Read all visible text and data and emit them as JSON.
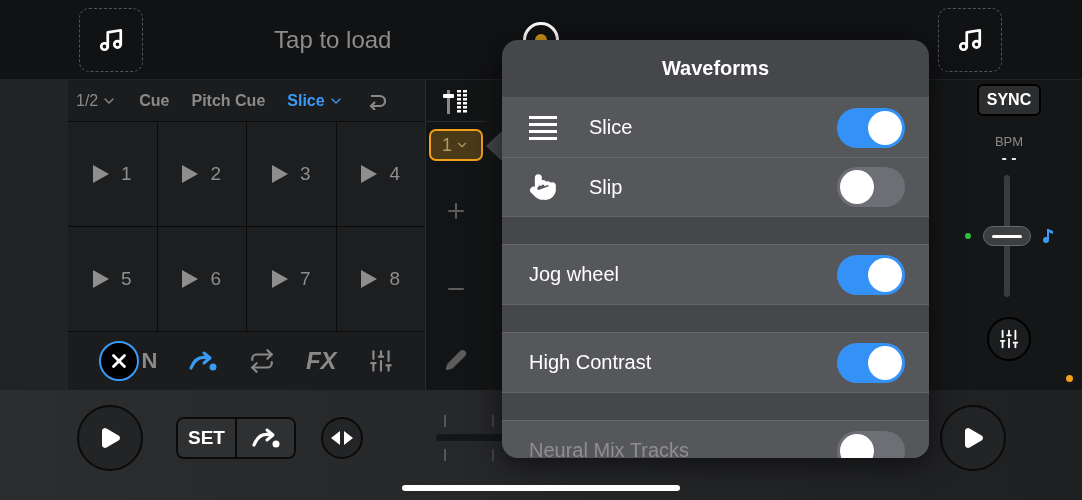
{
  "decks": [
    {
      "track": "Tap to load"
    }
  ],
  "pad_toolbar": {
    "page": "1/2",
    "modes": [
      {
        "label": "Cue",
        "selected": false
      },
      {
        "label": "Pitch Cue",
        "selected": false
      },
      {
        "label": "Slice",
        "selected": true
      }
    ]
  },
  "pads": [
    "1",
    "2",
    "3",
    "4",
    "5",
    "6",
    "7",
    "8"
  ],
  "tools": [
    {
      "kind": "stems",
      "label": "N",
      "on": true
    },
    {
      "kind": "cue",
      "on": true
    },
    {
      "kind": "loop",
      "on": false
    },
    {
      "kind": "fx",
      "label": "FX",
      "on": false
    },
    {
      "kind": "mixer",
      "on": false
    }
  ],
  "strip": {
    "zoom": "1"
  },
  "popup": {
    "title": "Waveforms",
    "sections": [
      {
        "rows": [
          {
            "kind": "slice",
            "label": "Slice",
            "on": true,
            "disabled": false
          },
          {
            "kind": "slip",
            "label": "Slip",
            "on": false,
            "disabled": false
          }
        ]
      },
      {
        "rows": [
          {
            "kind": "plain",
            "label": "Jog wheel",
            "on": true,
            "disabled": false
          }
        ]
      },
      {
        "rows": [
          {
            "kind": "plain",
            "label": "High Contrast",
            "on": true,
            "disabled": false
          }
        ]
      },
      {
        "rows": [
          {
            "kind": "plain",
            "label": "Neural Mix Tracks",
            "on": false,
            "disabled": true
          }
        ]
      }
    ]
  },
  "deck_b": {
    "sync": "SYNC",
    "bpm_label": "BPM",
    "bpm": "- -",
    "tempo": {
      "level": 0.5
    }
  },
  "transport": {
    "set": "SET"
  }
}
